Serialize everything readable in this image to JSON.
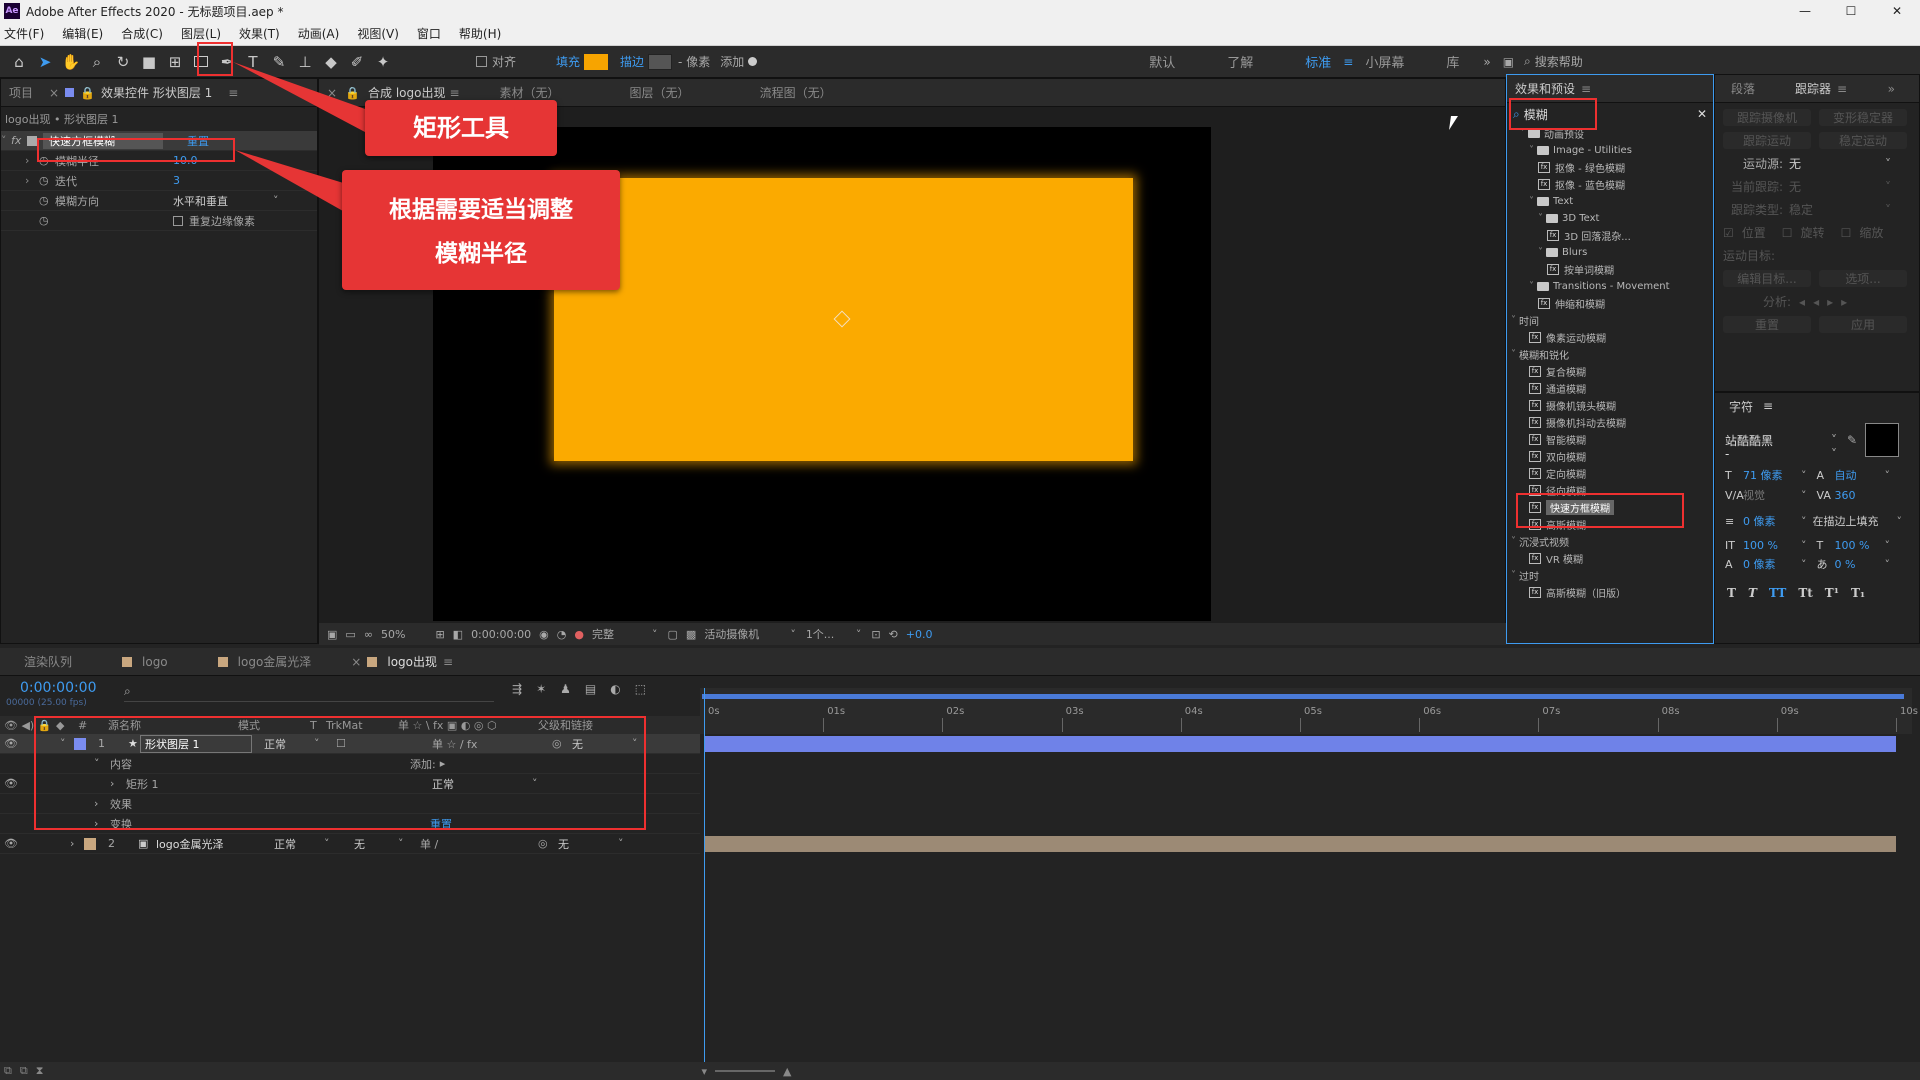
{
  "app": {
    "title": "Adobe After Effects 2020 - 无标题项目.aep *",
    "logo": "Ae"
  },
  "window_controls": {
    "min": "—",
    "max": "☐",
    "close": "✕"
  },
  "menu": [
    "文件(F)",
    "编辑(E)",
    "合成(C)",
    "图层(L)",
    "效果(T)",
    "动画(A)",
    "视图(V)",
    "窗口",
    "帮助(H)"
  ],
  "toolbar": {
    "align": "对齐",
    "fill": "填充",
    "stroke": "描边",
    "stroke_width": "- 像素",
    "add": "添加",
    "workspaces": [
      "默认",
      "了解",
      "标准",
      "小屏幕",
      "库"
    ],
    "search": "搜索帮助",
    "fill_color": "#f7a400"
  },
  "left_panel": {
    "tabs": [
      "项目",
      "效果控件 形状图层 1"
    ],
    "breadcrumb": "logo出现 • 形状图层 1",
    "effect_name": "快速方框模糊",
    "reset": "重置",
    "props": [
      {
        "name": "模糊半径",
        "value": "10.0"
      },
      {
        "name": "迭代",
        "value": "3"
      },
      {
        "name": "模糊方向",
        "value": "水平和垂直"
      },
      {
        "name": "",
        "value": "重复边缘像素"
      }
    ]
  },
  "comp_panel": {
    "tabs": [
      "合成 logo出现",
      "素材（无）",
      "图层（无）",
      "流程图（无）"
    ],
    "subtab": "logo",
    "footer": {
      "zoom": "50%",
      "time": "0:00:00:00",
      "quality": "完整",
      "camera": "活动摄像机",
      "views": "1个...",
      "exposure": "+0.0"
    }
  },
  "callouts": {
    "tool": "矩形工具",
    "blur_line1": "根据需要适当调整",
    "blur_line2": "模糊半径"
  },
  "effects_panel": {
    "title": "效果和预设",
    "search": "模糊",
    "tree": [
      {
        "d": 1,
        "t": "动画预设",
        "k": "fold"
      },
      {
        "d": 2,
        "t": "Image - Utilities",
        "k": "fold"
      },
      {
        "d": 3,
        "t": "抠像 - 绿色模糊",
        "k": "fx"
      },
      {
        "d": 3,
        "t": "抠像 - 蓝色模糊",
        "k": "fx"
      },
      {
        "d": 2,
        "t": "Text",
        "k": "fold"
      },
      {
        "d": 3,
        "t": "3D Text",
        "k": "fold"
      },
      {
        "d": 4,
        "t": "3D 回落混杂...",
        "k": "fx"
      },
      {
        "d": 3,
        "t": "Blurs",
        "k": "fold"
      },
      {
        "d": 4,
        "t": "按单词模糊",
        "k": "fx"
      },
      {
        "d": 2,
        "t": "Transitions - Movement",
        "k": "fold"
      },
      {
        "d": 3,
        "t": "伸缩和模糊",
        "k": "fx"
      },
      {
        "d": 0,
        "t": "时间",
        "k": "cat"
      },
      {
        "d": 2,
        "t": "像素运动模糊",
        "k": "fx"
      },
      {
        "d": 0,
        "t": "模糊和锐化",
        "k": "cat"
      },
      {
        "d": 2,
        "t": "复合模糊",
        "k": "fx"
      },
      {
        "d": 2,
        "t": "通道模糊",
        "k": "fx"
      },
      {
        "d": 2,
        "t": "摄像机镜头模糊",
        "k": "fx"
      },
      {
        "d": 2,
        "t": "摄像机抖动去模糊",
        "k": "fx"
      },
      {
        "d": 2,
        "t": "智能模糊",
        "k": "fx"
      },
      {
        "d": 2,
        "t": "双向模糊",
        "k": "fx"
      },
      {
        "d": 2,
        "t": "定向模糊",
        "k": "fx"
      },
      {
        "d": 2,
        "t": "径向模糊",
        "k": "fx"
      },
      {
        "d": 2,
        "t": "快速方框模糊",
        "k": "fx",
        "sel": true
      },
      {
        "d": 2,
        "t": "高斯模糊",
        "k": "fx"
      },
      {
        "d": 0,
        "t": "沉浸式视频",
        "k": "cat"
      },
      {
        "d": 2,
        "t": "VR 模糊",
        "k": "fx"
      },
      {
        "d": 0,
        "t": "过时",
        "k": "cat"
      },
      {
        "d": 2,
        "t": "高斯模糊（旧版）",
        "k": "fx"
      }
    ]
  },
  "tracker_panel": {
    "tabs": [
      "段落",
      "跟踪器"
    ],
    "btns": [
      "跟踪摄像机",
      "变形稳定器",
      "跟踪运动",
      "稳定运动"
    ],
    "motion_source_label": "运动源:",
    "motion_source": "无",
    "current_track_label": "当前跟踪:",
    "current_track": "无",
    "track_type_label": "跟踪类型:",
    "track_type": "稳定",
    "checks": [
      "位置",
      "旋转",
      "缩放"
    ],
    "target_label": "运动目标:",
    "edit_target": "编辑目标...",
    "options": "选项...",
    "analyze": "分析:",
    "reset": "重置",
    "apply": "应用"
  },
  "char_panel": {
    "title": "字符",
    "font": "站酷酷黑",
    "style": "-",
    "size": "71 像素",
    "leading": "自动",
    "kerning": "视觉",
    "tracking": "360",
    "stroke": "0 像素",
    "stroke_mode": "在描边上填充",
    "vscale": "100 %",
    "hscale": "100 %",
    "baseline": "0 像素",
    "tsume": "0 %",
    "styles": [
      "T",
      "T",
      "TT",
      "Tt",
      "T¹",
      "T₁"
    ]
  },
  "timeline": {
    "tabs": [
      "渲染队列",
      "logo",
      "logo金属光泽",
      "logo出现"
    ],
    "time": "0:00:00:00",
    "fps": "00000 (25.00 fps)",
    "cols": [
      "#",
      "源名称",
      "模式",
      "T",
      "TrkMat",
      "父级和链接"
    ],
    "ticks": [
      "0s",
      "01s",
      "02s",
      "03s",
      "04s",
      "05s",
      "06s",
      "07s",
      "08s",
      "09s",
      "10s"
    ],
    "layers": [
      {
        "num": "1",
        "name": "形状图层 1",
        "mode": "正常",
        "parent": "无",
        "color": "#7a8cf0"
      },
      {
        "num": "2",
        "name": "logo金属光泽",
        "mode": "正常",
        "trk": "无",
        "parent": "无",
        "color": "#c9a77f"
      }
    ],
    "sub": {
      "contents": "内容",
      "add": "添加:",
      "rect": "矩形 1",
      "rect_mode": "正常",
      "effects": "效果",
      "transform": "变换",
      "reset": "重置"
    }
  }
}
